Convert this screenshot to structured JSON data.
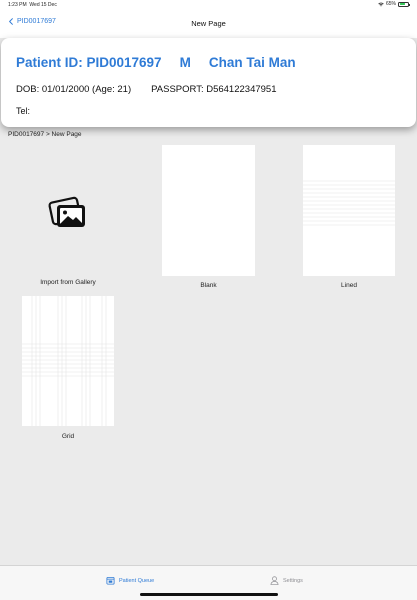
{
  "status_bar": {
    "time": "1:23 PM",
    "date": "Wed 15 Dec",
    "battery": "65%",
    "battery_level": 0.65
  },
  "nav": {
    "back_label": "PID0017697",
    "title": "New Page"
  },
  "patient": {
    "id_text": "Patient ID: PID0017697",
    "sex": "M",
    "name": "Chan Tai Man",
    "dob": "DOB: 01/01/2000 (Age: 21)",
    "passport": "PASSPORT: D564122347951",
    "tel": "Tel:"
  },
  "breadcrumb": "PID0017697 > New Page",
  "templates": [
    {
      "label": "Import from Gallery",
      "icon": "photo-gallery-icon"
    },
    {
      "label": "Blank"
    },
    {
      "label": "Lined"
    },
    {
      "label": "Grid"
    }
  ],
  "tab_bar": {
    "patient_queue": "Patient Queue",
    "settings": "Settings"
  },
  "colors": {
    "accent": "#2f7bd6",
    "background": "#ebebeb",
    "inactive_tab": "#8e8e93",
    "battery": "#34c759"
  }
}
